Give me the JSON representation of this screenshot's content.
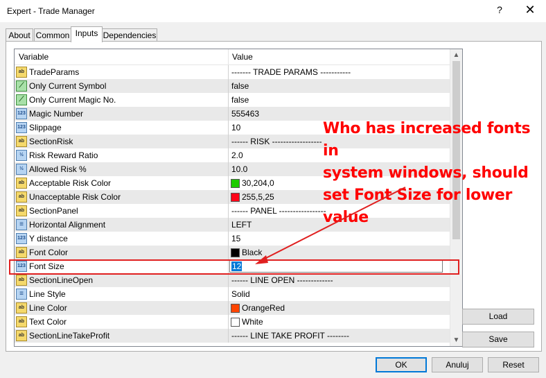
{
  "window": {
    "title": "Expert - Trade Manager",
    "help": "?",
    "close": "✕"
  },
  "tabs": [
    "About",
    "Common",
    "Inputs",
    "Dependencies"
  ],
  "active_tab": "Inputs",
  "grid": {
    "headers": {
      "variable": "Variable",
      "value": "Value"
    },
    "rows": [
      {
        "icon": "ab",
        "name": "TradeParams",
        "value": "------- TRADE PARAMS -----------"
      },
      {
        "icon": "bool",
        "name": "Only Current Symbol",
        "value": "false"
      },
      {
        "icon": "bool",
        "name": "Only Current Magic No.",
        "value": "false"
      },
      {
        "icon": "num",
        "name": "Magic Number",
        "value": "555463"
      },
      {
        "icon": "num",
        "name": "Slippage",
        "value": "10"
      },
      {
        "icon": "ab",
        "name": "SectionRisk",
        "value": "------ RISK ------------------"
      },
      {
        "icon": "dbl",
        "name": "Risk Reward Ratio",
        "value": "2.0"
      },
      {
        "icon": "dbl",
        "name": "Allowed Risk %",
        "value": "10.0"
      },
      {
        "icon": "color",
        "name": "Acceptable Risk Color",
        "value": "30,204,0",
        "swatch": "#1ecc00"
      },
      {
        "icon": "color",
        "name": "Unacceptable Risk Color",
        "value": "255,5,25",
        "swatch": "#ff0519"
      },
      {
        "icon": "ab",
        "name": "SectionPanel",
        "value": "------ PANEL -----------------"
      },
      {
        "icon": "enum",
        "name": "Horizontal Alignment",
        "value": "LEFT"
      },
      {
        "icon": "num",
        "name": "Y distance",
        "value": "15"
      },
      {
        "icon": "color",
        "name": "Font Color",
        "value": "Black",
        "swatch": "#000000"
      },
      {
        "icon": "num",
        "name": "Font Size",
        "value": "12",
        "editing": true
      },
      {
        "icon": "ab",
        "name": "SectionLineOpen",
        "value": "------ LINE OPEN -------------"
      },
      {
        "icon": "enum",
        "name": "Line Style",
        "value": "Solid"
      },
      {
        "icon": "color",
        "name": "Line Color",
        "value": "OrangeRed",
        "swatch": "#ff4500"
      },
      {
        "icon": "color",
        "name": "Text Color",
        "value": "White",
        "swatch": "#ffffff"
      },
      {
        "icon": "ab",
        "name": "SectionLineTakeProfit",
        "value": "------ LINE TAKE PROFIT --------"
      }
    ]
  },
  "icon_glyphs": {
    "ab": "ab",
    "bool": "⟋",
    "num": "123",
    "dbl": "½",
    "enum": "≡",
    "color": "ab"
  },
  "buttons": {
    "load": "Load",
    "save": "Save",
    "ok": "OK",
    "cancel": "Anuluj",
    "reset": "Reset"
  },
  "annotation": {
    "line1": "Who has increased fonts in",
    "line2": "system windows, should",
    "line3": "set Font Size for lower value"
  },
  "colors": {
    "annotation": "#ff0000",
    "selection": "#0078d7"
  }
}
